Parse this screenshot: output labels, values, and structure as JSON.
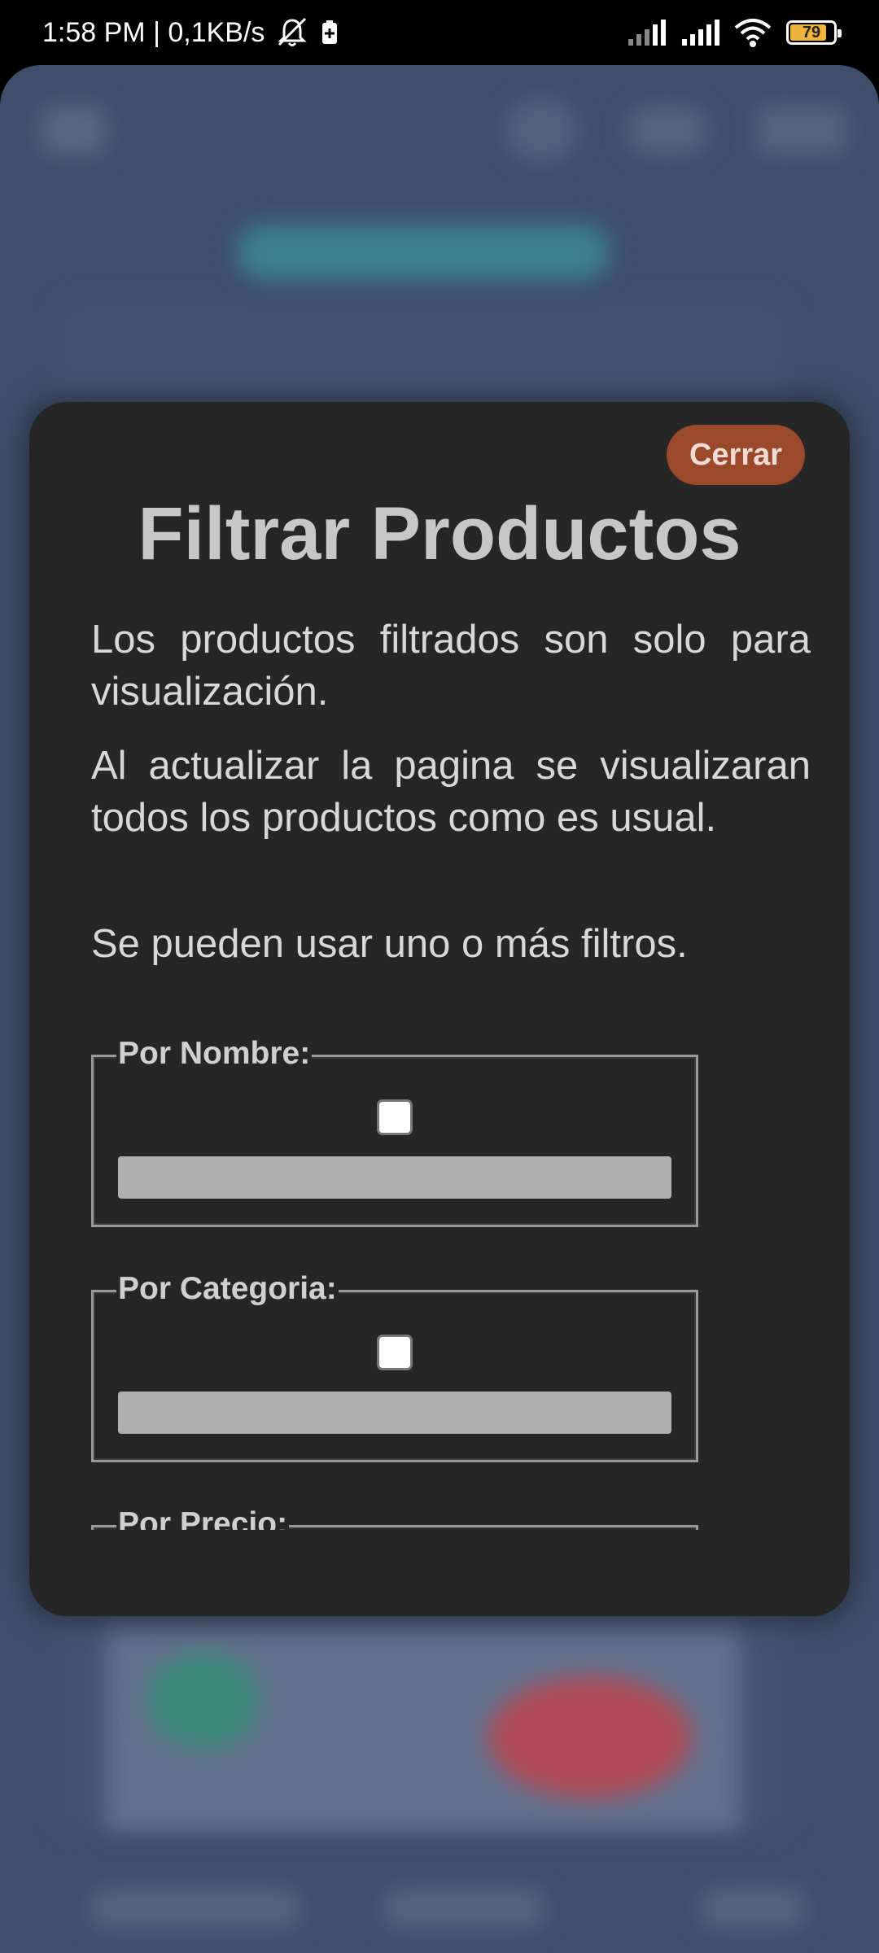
{
  "status_bar": {
    "time_speed": "1:58 PM | 0,1KB/s",
    "battery": "79",
    "icons": [
      "mute-bell-icon",
      "battery-saver-icon",
      "signal-icon",
      "signal-icon",
      "wifi-icon",
      "battery-icon"
    ]
  },
  "modal": {
    "close_label": "Cerrar",
    "title": "Filtrar Productos",
    "paragraphs": [
      "Los productos filtrados son solo para visualización.",
      "Al actualizar la pagina se visualizaran todos los productos como es usual.",
      "Se pueden usar uno o más filtros."
    ],
    "filters": [
      {
        "legend": "Por Nombre:",
        "checked": false,
        "value": ""
      },
      {
        "legend": "Por Categoria:",
        "checked": false,
        "value": ""
      },
      {
        "legend": "Por Precio:"
      }
    ]
  },
  "colors": {
    "modal_bg": "#262626",
    "close_button": "#9a4a2b",
    "app_bg": "#3f4e6a",
    "battery": "#f0b43a"
  }
}
